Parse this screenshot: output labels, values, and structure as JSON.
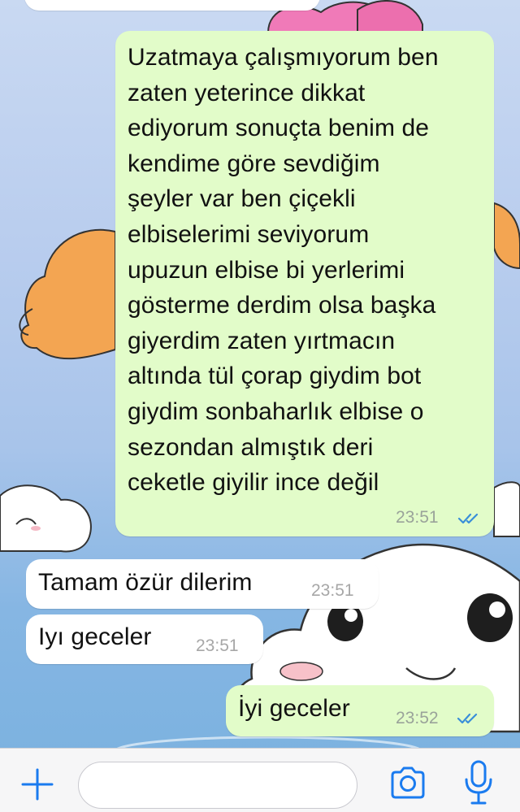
{
  "messages": [
    {
      "direction": "outgoing",
      "text": "Uzatmaya çalışmıyorum ben\nzaten yeterince dikkat\nediyorum sonuçta benim de\nkendime göre sevdiğim\nşeyler var ben çiçekli\nelbiselerimi seviyorum\nupuzun elbise bi yerlerimi\ngösterme derdim olsa başka\ngiyerdim zaten yırtmacın\naltında tül çorap giydim bot\ngiydim sonbaharlık elbise o\nsezondan almıştık deri\nceketle giyilir ince değil",
      "time": "23:51",
      "read": true
    },
    {
      "direction": "incoming",
      "text": "Tamam özür dilerim",
      "time": "23:51"
    },
    {
      "direction": "incoming",
      "text": "Iyı geceler",
      "time": "23:51"
    },
    {
      "direction": "outgoing",
      "text": "İyi geceler",
      "time": "23:52",
      "read": true
    }
  ],
  "input": {
    "placeholder": "",
    "value": ""
  },
  "colors": {
    "outgoing_bubble": "#e2fcc9",
    "incoming_bubble": "#ffffff",
    "tick": "#3a8fd9",
    "icon": "#1a7bef"
  },
  "icons": {
    "attach": "plus-icon",
    "camera": "camera-icon",
    "mic": "microphone-icon",
    "read_receipt": "double-check-icon"
  }
}
